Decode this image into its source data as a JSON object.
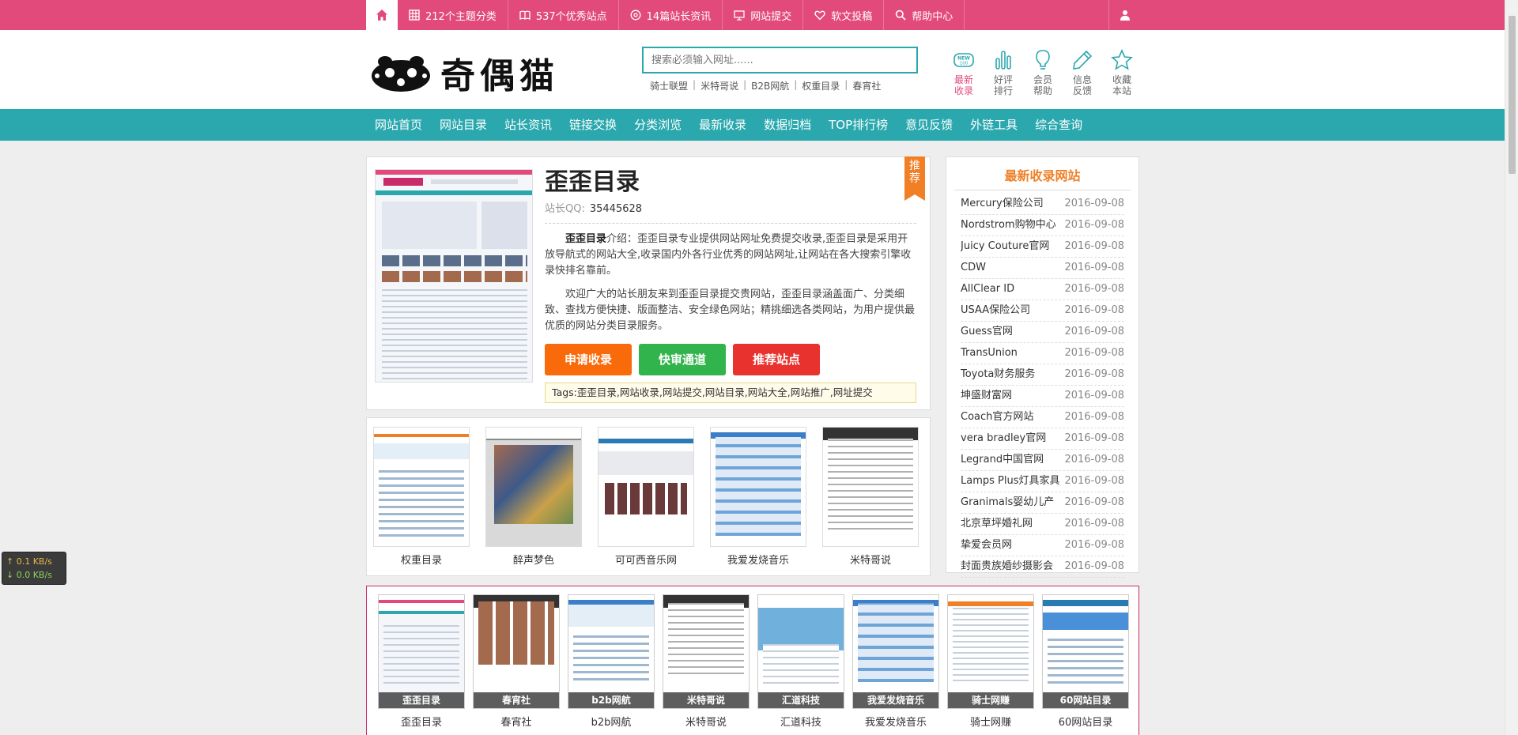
{
  "topbar": {
    "items": [
      {
        "label": "212个主题分类",
        "icon": "grid-icon"
      },
      {
        "label": "537个优秀站点",
        "icon": "book-icon"
      },
      {
        "label": "14篇站长资讯",
        "icon": "circle-icon"
      },
      {
        "label": "网站提交",
        "icon": "monitor-icon"
      },
      {
        "label": "软文投稿",
        "icon": "heart-icon"
      },
      {
        "label": "帮助中心",
        "icon": "search-icon"
      }
    ],
    "home_icon": "home-icon",
    "user_icon": "user-icon",
    "accent": "#e24a7b"
  },
  "header": {
    "logo_text": "奇偶猫",
    "search_placeholder": "搜索必须输入网址......",
    "hot_links": [
      "骑士联盟",
      "米特哥说",
      "B2B网航",
      "权重目录",
      "春宵社"
    ],
    "quick": [
      {
        "line1": "最新",
        "line2": "收录",
        "icon": "new-badge-icon",
        "active": true
      },
      {
        "line1": "好评",
        "line2": "排行",
        "icon": "bar-chart-icon"
      },
      {
        "line1": "会员",
        "line2": "帮助",
        "icon": "lightbulb-icon"
      },
      {
        "line1": "信息",
        "line2": "反馈",
        "icon": "pencil-icon"
      },
      {
        "line1": "收藏",
        "line2": "本站",
        "icon": "star-icon"
      }
    ]
  },
  "nav": [
    "网站首页",
    "网站目录",
    "站长资讯",
    "链接交换",
    "分类浏览",
    "最新收录",
    "数据归档",
    "TOP排行榜",
    "意见反馈",
    "外链工具",
    "综合查询"
  ],
  "speed": {
    "up": "↑ 0.1 KB/s",
    "down": "↓ 0.0 KB/s"
  },
  "detail": {
    "title": "歪歪目录",
    "qq_label": "站长QQ:",
    "qq": "35445628",
    "ribbon": "推荐",
    "intro_name": "歪歪目录",
    "intro_rest": "介绍：歪歪目录专业提供网站网址免费提交收录,歪歪目录是采用开放导航式的网站大全,收录国内外各行业优秀的网站网址,让网站在各大搜索引擎收录快排名靠前。",
    "para2": "欢迎广大的站长朋友来到歪歪目录提交贵网站，歪歪目录涵盖面广、分类细致、查找方便快捷、版面整洁、安全绿色网站；精挑细选各类网站，为用户提供最优质的网站分类目录服务。",
    "buttons": [
      {
        "label": "申请收录",
        "color": "#f96a0a"
      },
      {
        "label": "快审通道",
        "color": "#31b44b"
      },
      {
        "label": "推荐站点",
        "color": "#e8322e"
      }
    ],
    "tags": "Tags:歪歪目录,网站收录,网站提交,网站目录,网站大全,网站推广,网址提交"
  },
  "related": [
    "权重目录",
    "醉声梦色",
    "可可西音乐网",
    "我爱发烧音乐",
    "米特哥说"
  ],
  "latest": {
    "title": "最新收录网站",
    "rows": [
      {
        "name": "Mercury保险公司",
        "date": "2016-09-08"
      },
      {
        "name": "Nordstrom购物中心",
        "date": "2016-09-08"
      },
      {
        "name": "Juicy Couture官网",
        "date": "2016-09-08"
      },
      {
        "name": "CDW",
        "date": "2016-09-08"
      },
      {
        "name": "AllClear ID",
        "date": "2016-09-08"
      },
      {
        "name": "USAA保险公司",
        "date": "2016-09-08"
      },
      {
        "name": "Guess官网",
        "date": "2016-09-08"
      },
      {
        "name": "TransUnion",
        "date": "2016-09-08"
      },
      {
        "name": "Toyota财务服务",
        "date": "2016-09-08"
      },
      {
        "name": "坤盛财富网",
        "date": "2016-09-08"
      },
      {
        "name": "Coach官方网站",
        "date": "2016-09-08"
      },
      {
        "name": "vera bradley官网",
        "date": "2016-09-08"
      },
      {
        "name": "Legrand中国官网",
        "date": "2016-09-08"
      },
      {
        "name": "Lamps Plus灯具家具",
        "date": "2016-09-08"
      },
      {
        "name": "Granimals婴幼儿产",
        "date": "2016-09-08"
      },
      {
        "name": "北京草坪婚礼网",
        "date": "2016-09-08"
      },
      {
        "name": "挚爱会员网",
        "date": "2016-09-08"
      },
      {
        "name": "封面贵族婚纱摄影会",
        "date": "2016-09-08"
      }
    ]
  },
  "featured": [
    {
      "label": "歪歪目录",
      "caption": "歪歪目录"
    },
    {
      "label": "春宵社",
      "caption": "春宵社"
    },
    {
      "label": "b2b网航",
      "caption": "b2b网航"
    },
    {
      "label": "米特哥说",
      "caption": "米特哥说"
    },
    {
      "label": "汇道科技",
      "caption": "汇道科技"
    },
    {
      "label": "我爱发烧音乐",
      "caption": "我爱发烧音乐"
    },
    {
      "label": "骑士网赚",
      "caption": "骑士网赚"
    },
    {
      "label": "60网站目录",
      "caption": "60网站目录"
    }
  ],
  "colors": {
    "teal": "#2aa8ae",
    "pink": "#e24a7b",
    "orange": "#f07f26"
  }
}
